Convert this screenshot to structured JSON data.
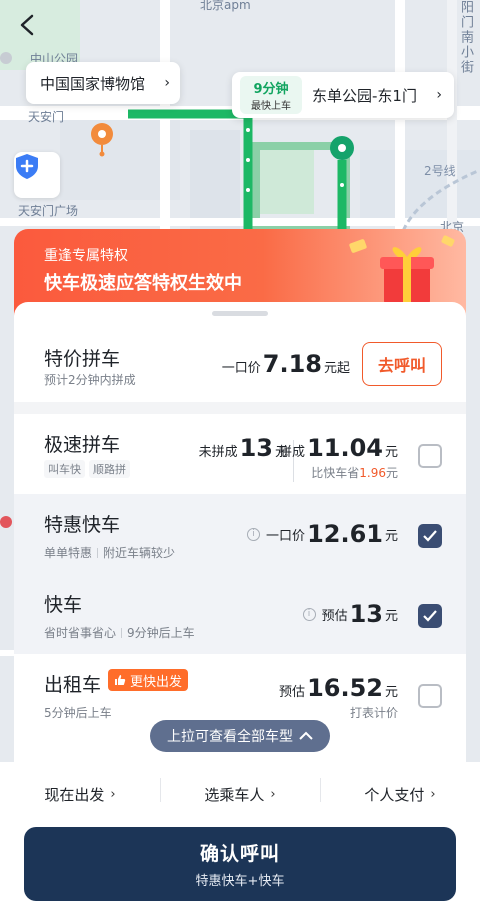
{
  "map": {
    "labels": {
      "beijing_apm": "北京apm",
      "wangfujing": "阳门南小街",
      "tiananmen": "天安门",
      "square": "天安门广场",
      "line2": "2号线",
      "zhongguo_gongyuan": "中山公园",
      "dongdan_station": "北京"
    },
    "start_place": "中国国家博物馆",
    "eta": {
      "minutes": "9分钟",
      "caption": "最快上车"
    },
    "end_place": "东单公园-东1门"
  },
  "promo": {
    "subtitle": "重逢专属特权",
    "title": "快车极速应答特权生效中"
  },
  "rides": [
    {
      "title": "特价拼车",
      "subtitle": "预计2分钟内拼成",
      "price_prefix": "一口价",
      "price": "7.18",
      "price_suffix": "元起",
      "action": "去呼叫"
    },
    {
      "title": "极速拼车",
      "tags": [
        "叫车快",
        "顺路拼"
      ],
      "price_a_prefix": "未拼成",
      "price_a": "13",
      "price_a_suffix": "元",
      "price_b_prefix": "拼成",
      "price_b": "11.04",
      "price_b_suffix": "元",
      "save_prefix": "比快车省",
      "save_amount": "1.96",
      "save_suffix": "元",
      "checked": false
    },
    {
      "title": "特惠快车",
      "subtitle_a": "单单特惠",
      "subtitle_b": "附近车辆较少",
      "price_prefix": "一口价",
      "price": "12.61",
      "price_suffix": "元",
      "checked": true
    },
    {
      "title": "快车",
      "subtitle_a": "省时省事省心",
      "subtitle_b": "9分钟后上车",
      "price_prefix": "预估",
      "price": "13",
      "price_suffix": "元",
      "checked": true
    },
    {
      "title": "出租车",
      "badge": "更快出发",
      "subtitle": "5分钟后上车",
      "price_prefix": "预估",
      "price": "16.52",
      "price_suffix": "元",
      "note": "打表计价",
      "checked": false
    }
  ],
  "pull_tip": "上拉可查看全部车型",
  "options": {
    "depart": "现在出发",
    "passenger": "选乘车人",
    "payment": "个人支付"
  },
  "confirm": {
    "title": "确认呼叫",
    "subtitle": "特惠快车+快车"
  },
  "colors": {
    "brand_orange": "#f15a2b",
    "route_green": "#1db865",
    "confirm_navy": "#1c3557",
    "checkbox_navy": "#3a4d73"
  }
}
